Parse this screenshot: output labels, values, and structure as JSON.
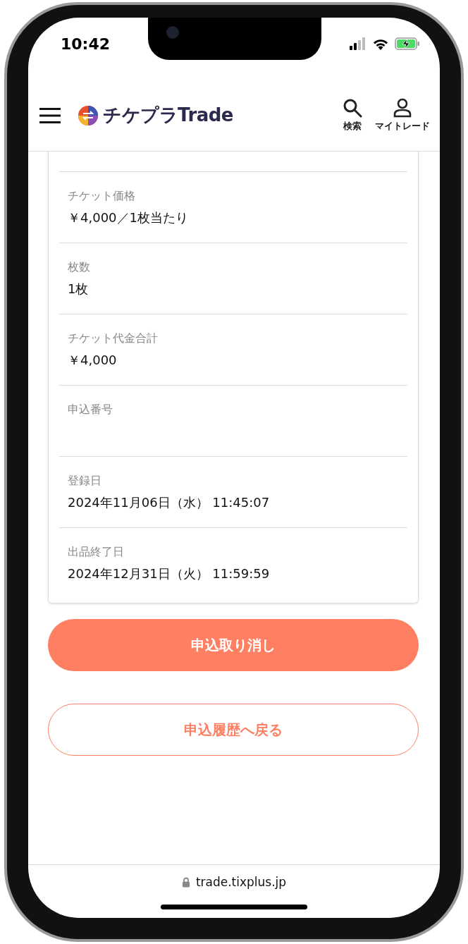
{
  "status_bar": {
    "time": "10:42"
  },
  "header": {
    "logo_text": "チケプラTrade",
    "actions": [
      {
        "kind": "search",
        "label": "検索"
      },
      {
        "kind": "user",
        "label": "マイトレード"
      }
    ]
  },
  "details": [
    {
      "label": "チケット価格",
      "value": "￥4,000／1枚当たり"
    },
    {
      "label": "枚数",
      "value": "1枚"
    },
    {
      "label": "チケット代金合計",
      "value": "￥4,000"
    },
    {
      "label": "申込番号"
    },
    {
      "label": "登録日",
      "value": "2024年11月06日（水） 11:45:07"
    },
    {
      "label": "出品終了日",
      "value": "2024年12月31日（火） 11:59:59"
    }
  ],
  "buttons": [
    {
      "kind": "primary",
      "label": "申込取り消し"
    },
    {
      "kind": "outline",
      "label": "申込履歴へ戻る"
    }
  ],
  "browser": {
    "url": "trade.tixplus.jp"
  }
}
